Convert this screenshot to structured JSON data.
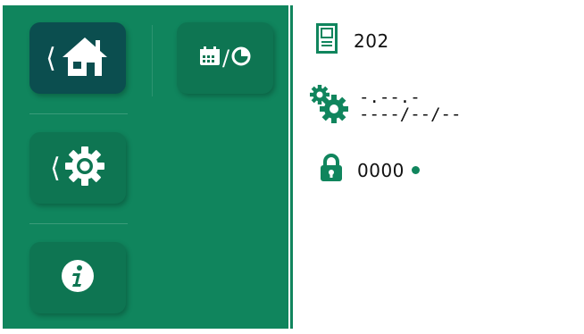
{
  "nav": {
    "home": {
      "icon": "home-icon",
      "arrow": "⟨"
    },
    "settings": {
      "icon": "gear-icon",
      "arrow": "⟨"
    },
    "info": {
      "icon": "info-icon"
    },
    "schedule": {
      "icon": "calendar-clock-icon",
      "separator": "/"
    }
  },
  "status": {
    "device_number": "202",
    "time_value": "-.--.-",
    "date_value": "----/--/--",
    "lock_code": "0000",
    "lock_indicator_color": "#10855d"
  },
  "colors": {
    "panel_green": "#10855d",
    "tile_green": "#0e7552",
    "tile_active": "#0b4e4f"
  }
}
